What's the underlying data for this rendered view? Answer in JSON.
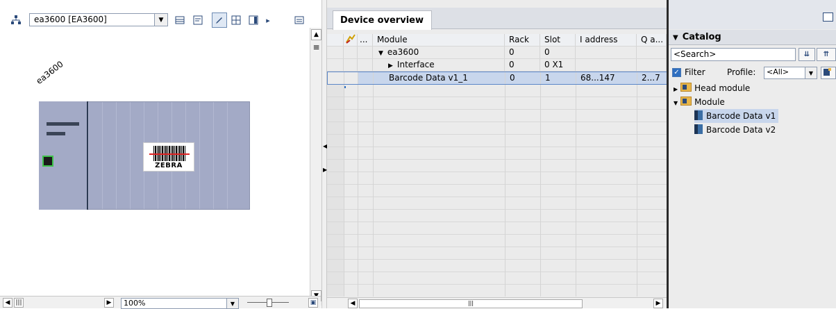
{
  "device_view": {
    "device_select_value": "ea3600 [EA3600]",
    "device_label": "ea3600",
    "module_vendor": "ZEBRA",
    "zoom_value": "100%"
  },
  "overview": {
    "tab_label": "Device overview",
    "columns": [
      "...",
      "Module",
      "Rack",
      "Slot",
      "I address",
      "Q a..."
    ],
    "rows": [
      {
        "module": "ea3600",
        "rack": "0",
        "slot": "0",
        "iaddr": "",
        "qaddr": "",
        "expand": "▼"
      },
      {
        "module": "Interface",
        "rack": "0",
        "slot": "0 X1",
        "iaddr": "",
        "qaddr": "",
        "expand": "▶"
      },
      {
        "module": "Barcode Data v1_1",
        "rack": "0",
        "slot": "1",
        "iaddr": "68...147",
        "qaddr": "2...7",
        "expand": ""
      }
    ]
  },
  "catalog": {
    "header": "Catalog",
    "search_placeholder": "<Search>",
    "filter_label": "Filter",
    "profile_label": "Profile:",
    "profile_value": "<All>",
    "tree": {
      "head_module": "Head module",
      "module": "Module",
      "item1": "Barcode Data v1",
      "item2": "Barcode Data v2"
    }
  },
  "colors": {
    "rack": "#a3aac6",
    "selection": "#c8d6ec",
    "port_border": "#3ec24a"
  }
}
